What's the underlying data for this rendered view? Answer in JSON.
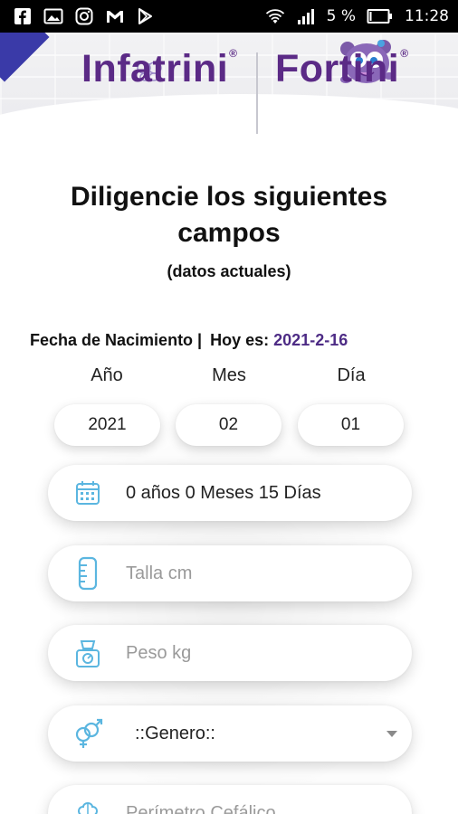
{
  "status_bar": {
    "battery_percent": "5 %",
    "time": "11:28",
    "left_icons": [
      "facebook-icon",
      "gallery-icon",
      "instagram-icon",
      "gmail-icon",
      "play-store-icon"
    ],
    "right_icons": [
      "wifi-icon",
      "signal-icon",
      "battery-icon"
    ]
  },
  "header": {
    "brand_left": "Infatrini",
    "brand_right": "Fortini",
    "registered_mark": "®"
  },
  "form": {
    "title_line1": "Diligencie los siguientes",
    "title_line2": "campos",
    "subtitle": "(datos actuales)",
    "dob_label": "Fecha de Nacimiento |",
    "today_label": "Hoy es:",
    "today_value": "2021-2-16",
    "columns": {
      "year": "Año",
      "month": "Mes",
      "day": "Día"
    },
    "values": {
      "year": "2021",
      "month": "02",
      "day": "01"
    },
    "age": "0 años 0 Meses 15 Días",
    "height_placeholder": "Talla cm",
    "weight_placeholder": "Peso kg",
    "gender_select": "::Genero::",
    "head_placeholder": "Perímetro Cefálico"
  },
  "colors": {
    "brand_purple": "#5b2a86",
    "today_value": "#4d2b85",
    "icon_blue": "#5bb6e0"
  }
}
